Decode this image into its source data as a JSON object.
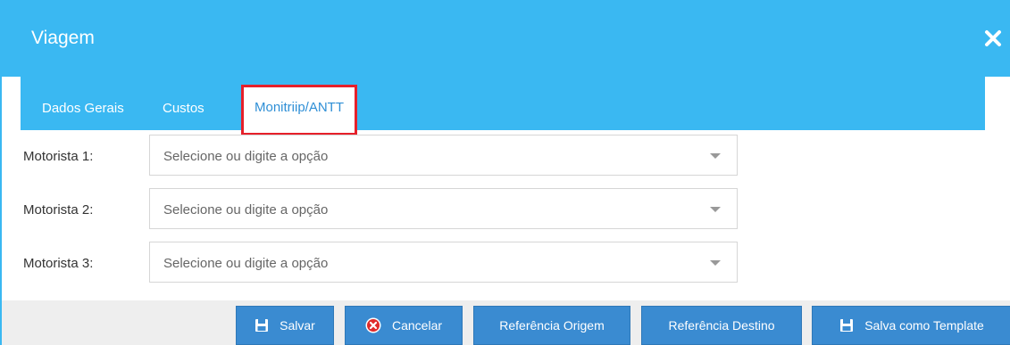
{
  "dialog": {
    "title": "Viagem",
    "close_icon": "close-icon"
  },
  "tabs": [
    {
      "label": "Dados Gerais",
      "active": false
    },
    {
      "label": "Custos",
      "active": false
    },
    {
      "label": "Monitriip/ANTT",
      "active": true
    }
  ],
  "form": {
    "rows": [
      {
        "label": "Motorista 1:",
        "placeholder": "Selecione ou digite a opção"
      },
      {
        "label": "Motorista 2:",
        "placeholder": "Selecione ou digite a opção"
      },
      {
        "label": "Motorista 3:",
        "placeholder": "Selecione ou digite a opção"
      }
    ]
  },
  "footer": {
    "buttons": [
      {
        "label": "Salvar",
        "icon": "floppy-icon"
      },
      {
        "label": "Cancelar",
        "icon": "cancel-circle-icon"
      },
      {
        "label": "Referência Origem",
        "icon": ""
      },
      {
        "label": "Referência Destino",
        "icon": ""
      },
      {
        "label": "Salva como Template",
        "icon": "floppy-icon"
      }
    ]
  },
  "colors": {
    "header": "#3ab8f2",
    "active_tab_text": "#2f8fd6",
    "active_tab_outline": "#e6202a",
    "button": "#3a8bd1",
    "cancel_icon": "#e02b2b",
    "footer_bg": "#eeeeee"
  }
}
